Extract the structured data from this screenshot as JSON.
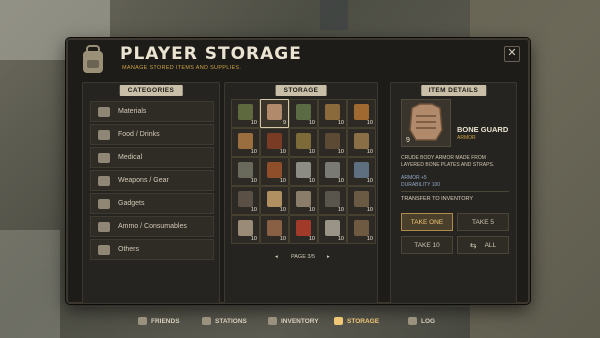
{
  "header": {
    "title": "PLAYER STORAGE",
    "subtitle": "MANAGE STORED ITEMS AND SUPPLIES.",
    "close_label": "✕"
  },
  "categories": {
    "header": "CATEGORIES",
    "items": [
      {
        "label": "Materials",
        "icon": "materials-icon"
      },
      {
        "label": "Food / Drinks",
        "icon": "food-icon"
      },
      {
        "label": "Medical",
        "icon": "medical-icon"
      },
      {
        "label": "Weapons / Gear",
        "icon": "weapons-icon"
      },
      {
        "label": "Gadgets",
        "icon": "gadgets-icon"
      },
      {
        "label": "Ammo / Consumables",
        "icon": "ammo-icon"
      },
      {
        "label": "Others",
        "icon": "others-icon"
      }
    ]
  },
  "storage": {
    "header": "STORAGE",
    "slots": [
      {
        "qty": "10",
        "color": "#5e6a3d",
        "icon": "jacket-icon"
      },
      {
        "qty": "9",
        "color": "#b08a6a",
        "icon": "bone-armor-icon",
        "selected": true
      },
      {
        "qty": "10",
        "color": "#5b6b44",
        "icon": "jacket-icon"
      },
      {
        "qty": "10",
        "color": "#8a6a3a",
        "icon": "vest-icon"
      },
      {
        "qty": "10",
        "color": "#a0692f",
        "icon": "vest-icon"
      },
      {
        "qty": "10",
        "color": "#9a6e3f",
        "icon": "vest-icon"
      },
      {
        "qty": "10",
        "color": "#7a3b24",
        "icon": "armor-icon"
      },
      {
        "qty": "10",
        "color": "#7c6a38",
        "icon": "vest-icon"
      },
      {
        "qty": "10",
        "color": "#5c4a34",
        "icon": "vest-icon"
      },
      {
        "qty": "10",
        "color": "#8a6e45",
        "icon": "vest-icon"
      },
      {
        "qty": "10",
        "color": "#6a6a5c",
        "icon": "vest-icon"
      },
      {
        "qty": "10",
        "color": "#8e4e2a",
        "icon": "jacket-icon"
      },
      {
        "qty": "10",
        "color": "#8c8c85",
        "icon": "vest-icon"
      },
      {
        "qty": "10",
        "color": "#7a7a75",
        "icon": "armor-icon"
      },
      {
        "qty": "10",
        "color": "#5e7080",
        "icon": "jacket-icon"
      },
      {
        "qty": "10",
        "color": "#5a5045",
        "icon": "rifle-icon"
      },
      {
        "qty": "10",
        "color": "#b09060",
        "icon": "bat-icon"
      },
      {
        "qty": "10",
        "color": "#8a7e6a",
        "icon": "knife-icon"
      },
      {
        "qty": "10",
        "color": "#5a554c",
        "icon": "smg-icon"
      },
      {
        "qty": "10",
        "color": "#6a5a44",
        "icon": "rifle-icon"
      },
      {
        "qty": "10",
        "color": "#9a8a78",
        "icon": "crowbar-icon"
      },
      {
        "qty": "10",
        "color": "#8a6044",
        "icon": "bat-icon"
      },
      {
        "qty": "10",
        "color": "#a23a2a",
        "icon": "axe-icon"
      },
      {
        "qty": "10",
        "color": "#9a9488",
        "icon": "pistol-icon"
      },
      {
        "qty": "10",
        "color": "#6e5a40",
        "icon": "shotgun-icon"
      }
    ],
    "pager": {
      "prev": "◂",
      "page": "PAGE 3/5",
      "next": "▸"
    }
  },
  "details": {
    "header": "ITEM DETAILS",
    "name": "BONE GUARD",
    "type": "ARMOR",
    "qty": "9",
    "description": "CRUDE BODY ARMOR MADE FROM LAYERED BONE PLATES AND STRAPS.",
    "stat1": "ARMOR +5",
    "stat2": "DURABILITY 100",
    "transfer_label": "TRANSFER TO INVENTORY",
    "buttons": {
      "take_one": "TAKE ONE",
      "take_five": "TAKE 5",
      "take_ten": "TAKE 10",
      "all": "ALL"
    }
  },
  "nav": [
    {
      "label": "FRIENDS",
      "icon": "friends-icon"
    },
    {
      "label": "STATIONS",
      "icon": "stations-icon"
    },
    {
      "label": "INVENTORY",
      "icon": "inventory-icon"
    },
    {
      "label": "STORAGE",
      "icon": "storage-icon",
      "active": true
    },
    {
      "label": "LOG",
      "icon": "log-icon"
    }
  ],
  "colors": {
    "accent": "#f0c777",
    "panel": "#1d1c18",
    "header_tab": "#c9bfa9"
  }
}
